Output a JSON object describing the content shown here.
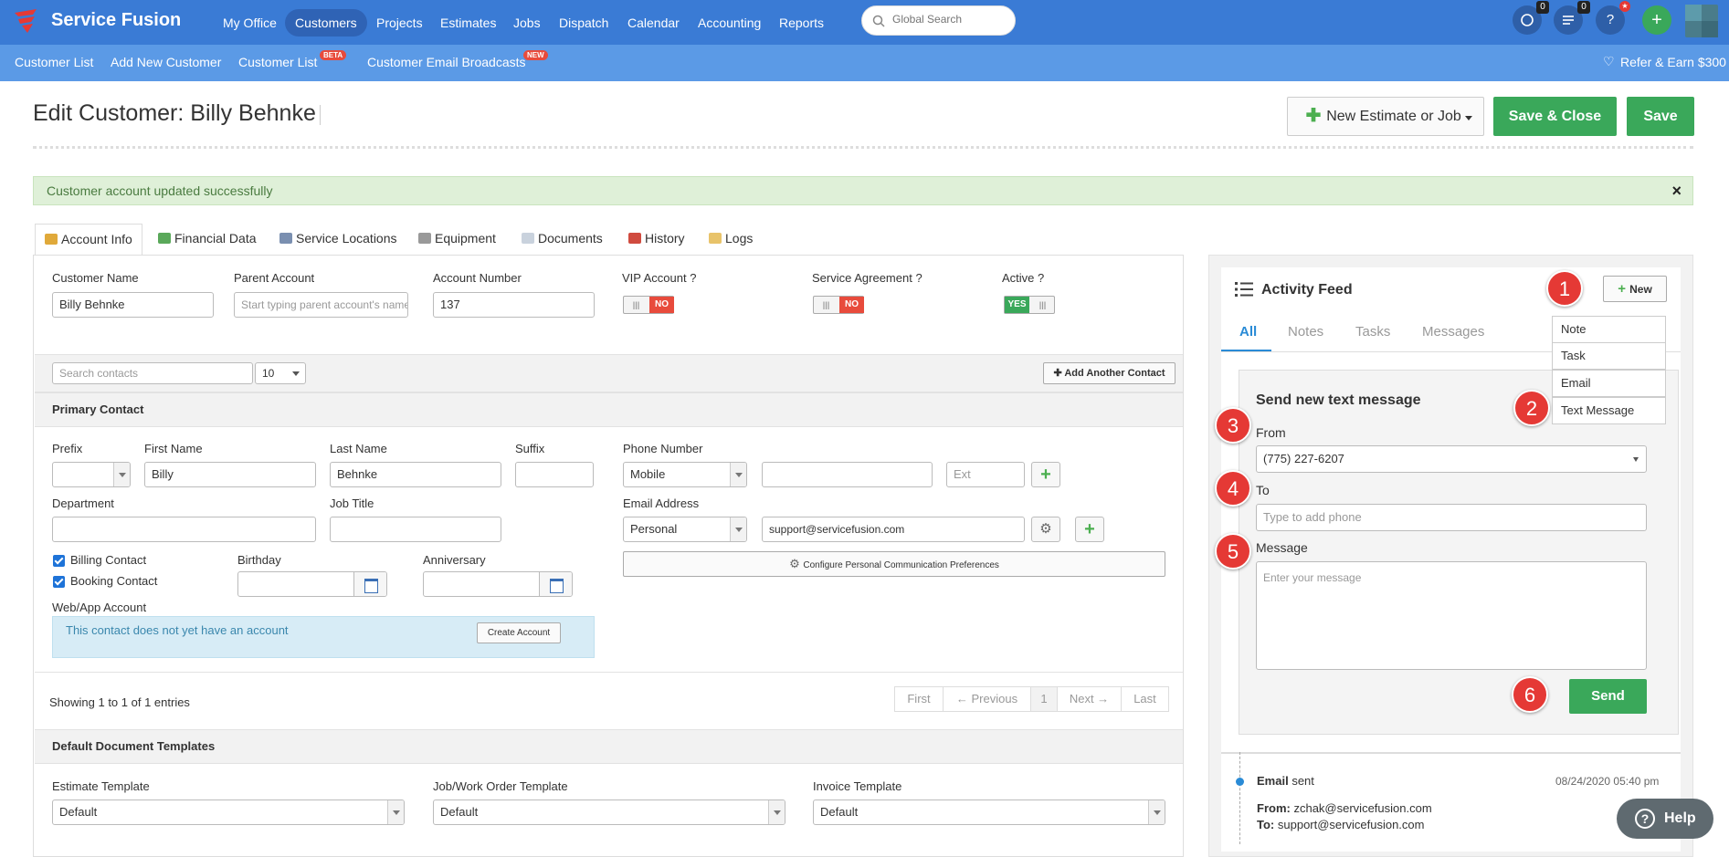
{
  "app": {
    "logo_text": "Service Fusion"
  },
  "nav": {
    "items": [
      {
        "label": "My Office"
      },
      {
        "label": "Customers"
      },
      {
        "label": "Projects"
      },
      {
        "label": "Estimates"
      },
      {
        "label": "Jobs"
      },
      {
        "label": "Dispatch"
      },
      {
        "label": "Calendar"
      },
      {
        "label": "Accounting"
      },
      {
        "label": "Reports"
      }
    ],
    "search_placeholder": "Global Search",
    "chat_count": "0",
    "list_count": "0",
    "help_label": "?",
    "add_label": "+"
  },
  "subnav": {
    "items": [
      {
        "label": "Customer List"
      },
      {
        "label": "Add New Customer"
      },
      {
        "label": "Customer List",
        "badge": "BETA"
      },
      {
        "label": "Customer Email Broadcasts",
        "badge": "NEW"
      }
    ],
    "refer": "Refer & Earn $300"
  },
  "header": {
    "title": "Edit Customer: Billy Behnke",
    "new_estimate_label": "New Estimate or Job",
    "save_close_label": "Save & Close",
    "save_label": "Save"
  },
  "alert": {
    "message": "Customer account updated successfully",
    "close": "×"
  },
  "tabs": [
    {
      "label": "Account Info"
    },
    {
      "label": "Financial Data"
    },
    {
      "label": "Service Locations"
    },
    {
      "label": "Equipment"
    },
    {
      "label": "Documents"
    },
    {
      "label": "History"
    },
    {
      "label": "Logs"
    }
  ],
  "account": {
    "customer_name_label": "Customer Name",
    "customer_name": "Billy Behnke",
    "parent_label": "Parent Account",
    "parent_placeholder": "Start typing parent account's name",
    "account_number_label": "Account Number",
    "account_number": "137",
    "vip_label": "VIP Account ?",
    "vip_value": "NO",
    "service_label": "Service Agreement ?",
    "service_value": "NO",
    "active_label": "Active ?",
    "active_value": "YES"
  },
  "contacts": {
    "search_placeholder": "Search contacts",
    "page_size": "10",
    "add_contact_label": "Add Another Contact",
    "primary_heading": "Primary Contact",
    "prefix_label": "Prefix",
    "first_name_label": "First Name",
    "first_name": "Billy",
    "last_name_label": "Last Name",
    "last_name": "Behnke",
    "suffix_label": "Suffix",
    "phone_label": "Phone Number",
    "phone_type": "Mobile",
    "ext_placeholder": "Ext",
    "department_label": "Department",
    "job_title_label": "Job Title",
    "email_label": "Email Address",
    "email_type": "Personal",
    "email": "support@servicefusion.com",
    "billing_label": "Billing Contact",
    "booking_label": "Booking Contact",
    "birthday_label": "Birthday",
    "anniversary_label": "Anniversary",
    "configure_label": "Configure Personal Communication Preferences",
    "web_account_label": "Web/App Account",
    "no_account_msg": "This contact does not yet have an account",
    "create_account_label": "Create Account",
    "showing": "Showing 1 to 1 of 1 entries",
    "pager": {
      "first": "First",
      "previous": "← Previous",
      "page": "1",
      "next": "Next →",
      "last": "Last"
    }
  },
  "templates": {
    "heading": "Default Document Templates",
    "estimate_label": "Estimate Template",
    "estimate_value": "Default",
    "job_label": "Job/Work Order Template",
    "job_value": "Default",
    "invoice_label": "Invoice Template",
    "invoice_value": "Default"
  },
  "feed": {
    "title": "Activity Feed",
    "new_label": "New",
    "tabs": [
      {
        "label": "All"
      },
      {
        "label": "Notes"
      },
      {
        "label": "Tasks"
      },
      {
        "label": "Messages"
      }
    ],
    "menu": [
      {
        "label": "Note"
      },
      {
        "label": "Task"
      },
      {
        "label": "Email"
      },
      {
        "label": "Text Message"
      }
    ],
    "form": {
      "heading": "Send new text message",
      "from_label": "From",
      "from_value": "(775) 227-6207",
      "to_label": "To",
      "to_placeholder": "Type to add phone",
      "message_label": "Message",
      "message_placeholder": "Enter your message",
      "send_label": "Send"
    },
    "entry": {
      "type": "Email",
      "status": "sent",
      "timestamp": "08/24/2020 05:40 pm",
      "from_label": "From:",
      "from": "zchak@servicefusion.com",
      "to_label": "To:",
      "to": "support@servicefusion.com"
    }
  },
  "markers": [
    "1",
    "2",
    "3",
    "4",
    "5",
    "6"
  ],
  "help_label": "Help",
  "colors": {
    "nav": "#3a7bd5",
    "subnav": "#5b9ae6",
    "green": "#3aa85a",
    "marker": "#e53935",
    "accent": "#2a8bd6"
  }
}
